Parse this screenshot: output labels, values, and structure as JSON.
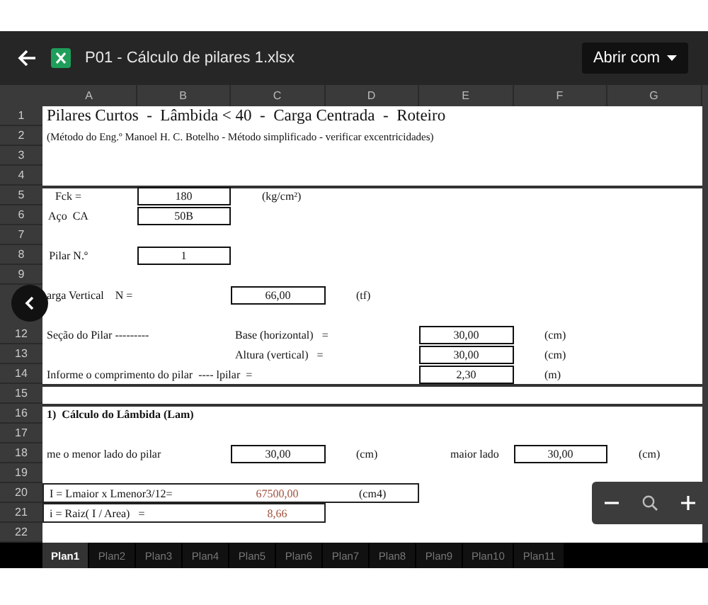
{
  "header": {
    "file_name": "P01 - Cálculo de pilares 1.xlsx",
    "open_with": "Abrir com"
  },
  "columns": [
    "A",
    "B",
    "C",
    "D",
    "E",
    "F",
    "G"
  ],
  "rows": [
    {
      "number": "1",
      "cells": {
        "A": {
          "kind": "title",
          "text": "Pilares Curtos  -  Lâmbida < 40  -  Carga Centrada  -  Roteiro"
        }
      }
    },
    {
      "number": "2",
      "cells": {
        "A": {
          "kind": "note",
          "text": "(Método do Eng.º Manoel H. C. Botelho - Método simplificado - verificar excentricidades)"
        }
      }
    },
    {
      "number": "3",
      "cells": {}
    },
    {
      "number": "4",
      "cells": {}
    },
    {
      "number": "5",
      "top_rule": true,
      "cells": {
        "A": {
          "kind": "label",
          "text": "Fck ="
        },
        "B": {
          "kind": "boxed",
          "text": "180"
        },
        "C": {
          "kind": "unit",
          "text": "(kg/cm²)"
        }
      }
    },
    {
      "number": "6",
      "cells": {
        "A": {
          "kind": "label",
          "text": "Aço  CA"
        },
        "B": {
          "kind": "boxed",
          "text": "50B"
        }
      }
    },
    {
      "number": "7",
      "cells": {}
    },
    {
      "number": "8",
      "cells": {
        "A": {
          "kind": "label",
          "text": "Pilar N.º"
        },
        "B": {
          "kind": "boxed",
          "text": "1"
        }
      }
    },
    {
      "number": "9",
      "cells": {}
    },
    {
      "cells": {
        "A": {
          "kind": "text",
          "text": "arga Vertical    N ="
        },
        "C": {
          "kind": "boxed",
          "text": "66,00"
        },
        "D": {
          "kind": "unit",
          "text": "(tf)"
        }
      }
    },
    {
      "cells": {}
    },
    {
      "number": "12",
      "cells": {
        "A": {
          "kind": "text",
          "text": "Seção do Pilar ---------"
        },
        "C": {
          "kind": "text",
          "text": "Base (horizontal)   ="
        },
        "E": {
          "kind": "boxed",
          "text": "30,00"
        },
        "F": {
          "kind": "unit",
          "text": "(cm)"
        }
      }
    },
    {
      "number": "13",
      "cells": {
        "C": {
          "kind": "text",
          "text": "Altura (vertical)   ="
        },
        "E": {
          "kind": "boxed",
          "text": "30,00"
        },
        "F": {
          "kind": "unit",
          "text": "(cm)"
        }
      }
    },
    {
      "number": "14",
      "cells": {
        "A": {
          "kind": "text",
          "text": "Informe o comprimento do pilar  ---- lpilar  ="
        },
        "E": {
          "kind": "boxed",
          "text": "2,30"
        },
        "F": {
          "kind": "unit",
          "text": "(m)"
        }
      }
    },
    {
      "number": "15",
      "top_rule": true,
      "cells": {}
    },
    {
      "number": "16",
      "top_rule": true,
      "cells": {
        "A": {
          "kind": "bold",
          "text": "1)  Cálculo do Lâmbida (Lam)"
        }
      }
    },
    {
      "number": "17",
      "cells": {}
    },
    {
      "number": "18",
      "cells": {
        "A": {
          "kind": "text",
          "text": "me o menor lado do pilar"
        },
        "C": {
          "kind": "boxed",
          "text": "30,00"
        },
        "D": {
          "kind": "unit",
          "text": "(cm)"
        },
        "E": {
          "kind": "unit",
          "text": "maior lado"
        },
        "F": {
          "kind": "boxed",
          "text": "30,00"
        },
        "G": {
          "kind": "unit",
          "text": "(cm)"
        }
      }
    },
    {
      "number": "19",
      "cells": {}
    },
    {
      "number": "20",
      "framed": true,
      "cells": {
        "A": {
          "kind": "text",
          "text": "I = Lmaior x Lmenor3/12="
        },
        "C": {
          "kind": "result",
          "text": "67500,00"
        },
        "D": {
          "kind": "unit",
          "text": "(cm4)"
        }
      }
    },
    {
      "number": "21",
      "framed": true,
      "cells": {
        "A": {
          "kind": "text",
          "text": "i = Raiz( I / Area)   ="
        },
        "C": {
          "kind": "result",
          "text": "8,66"
        }
      }
    },
    {
      "number": "22",
      "cells": {}
    }
  ],
  "sheet_tabs": [
    {
      "label": "Plan1",
      "selected": true
    },
    {
      "label": "Plan2",
      "selected": false
    },
    {
      "label": "Plan3",
      "selected": false
    },
    {
      "label": "Plan4",
      "selected": false
    },
    {
      "label": "Plan5",
      "selected": false
    },
    {
      "label": "Plan6",
      "selected": false
    },
    {
      "label": "Plan7",
      "selected": false
    },
    {
      "label": "Plan8",
      "selected": false
    },
    {
      "label": "Plan9",
      "selected": false
    },
    {
      "label": "Plan10",
      "selected": false
    },
    {
      "label": "Plan11",
      "selected": false
    }
  ]
}
